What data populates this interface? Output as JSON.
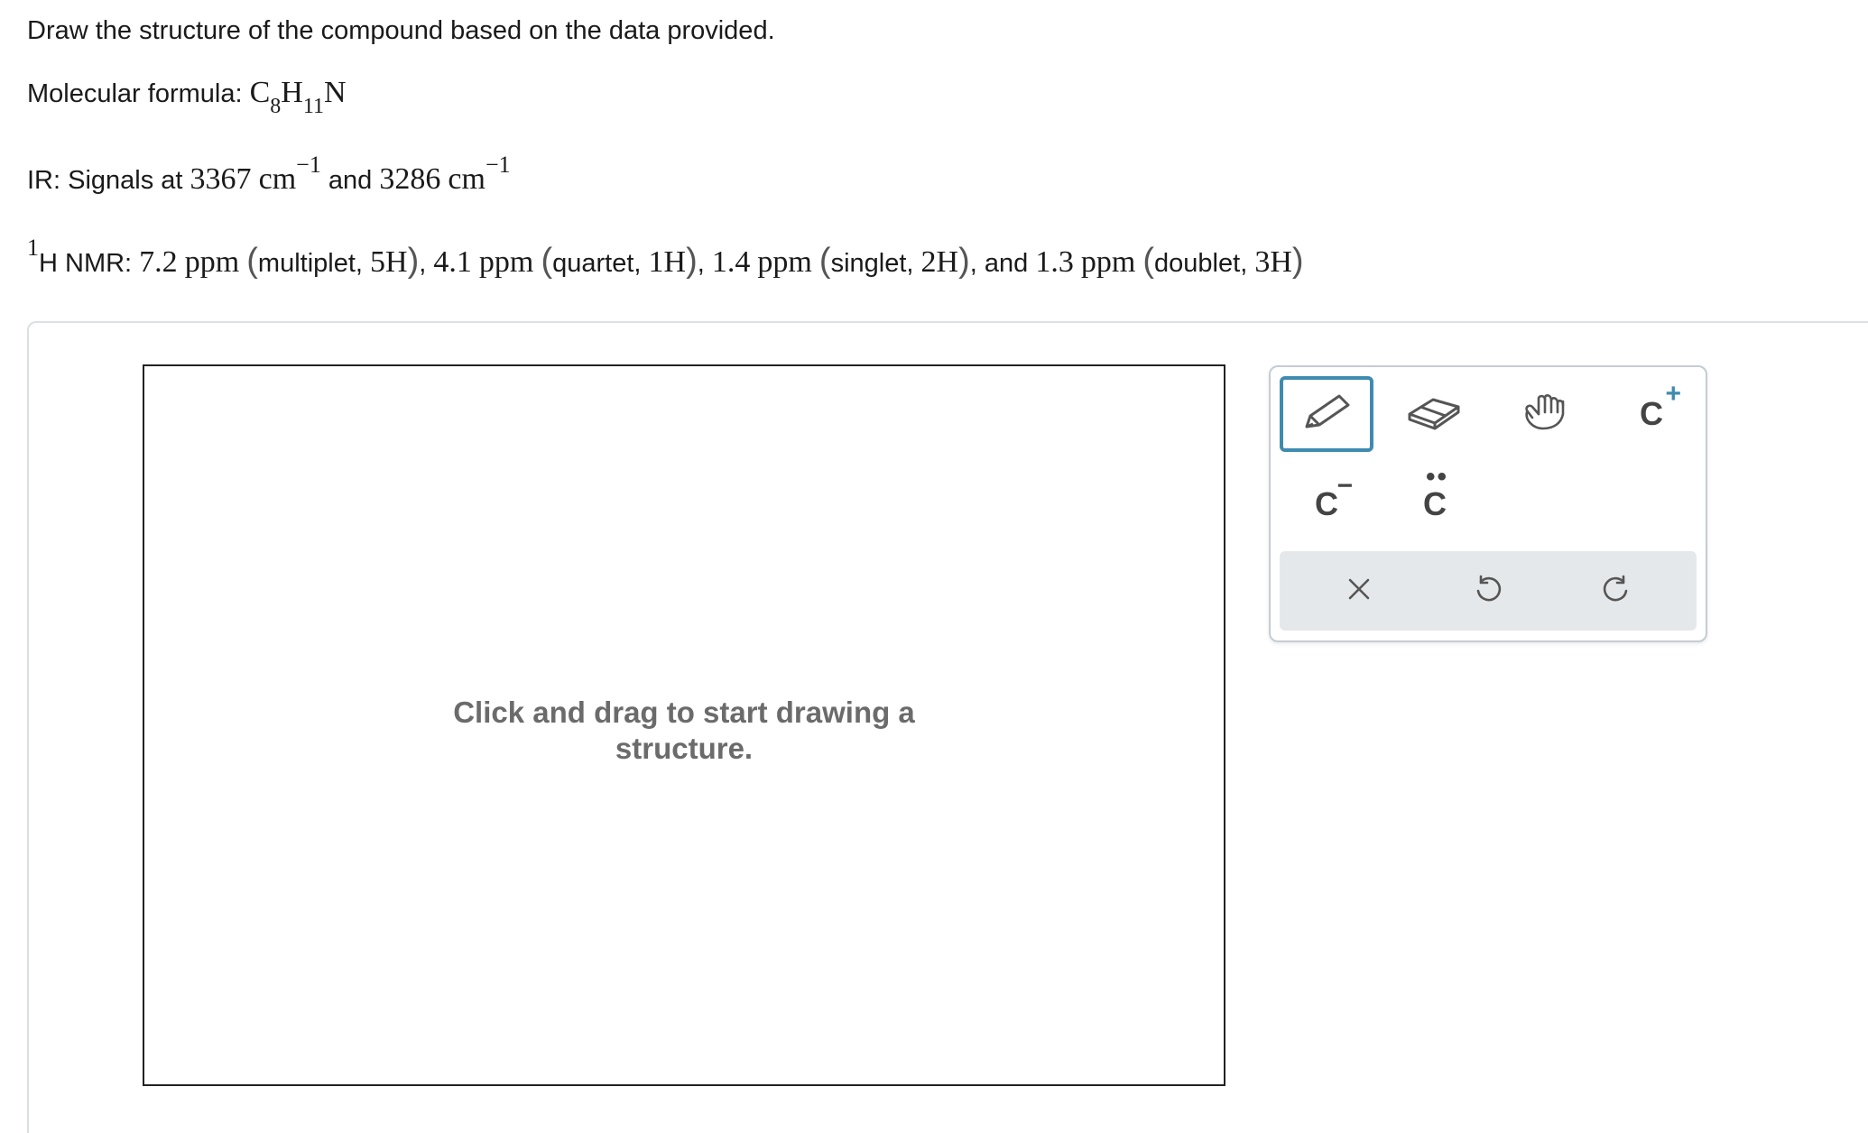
{
  "question": {
    "title": "Draw the structure of the compound based on the data provided.",
    "formula_label": "Molecular formula:",
    "formula": {
      "c": "C",
      "c_sub": "8",
      "h": "H",
      "h_sub": "11",
      "n": "N"
    },
    "ir": {
      "label": "IR: Signals at",
      "value1": "3367",
      "unit1": "cm",
      "sup1": "−1",
      "and": "and",
      "value2": "3286",
      "unit2": "cm",
      "sup2": "−1"
    },
    "nmr": {
      "sup": "1",
      "label": "H NMR:",
      "signals": [
        {
          "ppm": "7.2",
          "unit": "ppm",
          "mult": "multiplet,",
          "count": "5H",
          "sep": ","
        },
        {
          "ppm": "4.1",
          "unit": "ppm",
          "mult": "quartet,",
          "count": "1H",
          "sep": ","
        },
        {
          "ppm": "1.4",
          "unit": "ppm",
          "mult": "singlet,",
          "count": "2H",
          "sep": ", and"
        },
        {
          "ppm": "1.3",
          "unit": "ppm",
          "mult": "doublet,",
          "count": "3H",
          "sep": ""
        }
      ]
    }
  },
  "canvas": {
    "hint": "Click and drag to start drawing a structure."
  },
  "toolbar": {
    "accent": "#3f8bb0",
    "tools": [
      {
        "name": "pencil-icon",
        "selected": true
      },
      {
        "name": "eraser-icon"
      },
      {
        "name": "hand-icon"
      },
      {
        "name": "carbocation-icon",
        "label": "C",
        "mark": "+"
      },
      {
        "name": "carbanion-icon",
        "label": "C",
        "mark": "−"
      },
      {
        "name": "lone-pair-icon",
        "label": "C",
        "mark": ".."
      }
    ],
    "actions": [
      {
        "name": "clear-icon"
      },
      {
        "name": "undo-icon"
      },
      {
        "name": "redo-icon"
      }
    ]
  }
}
